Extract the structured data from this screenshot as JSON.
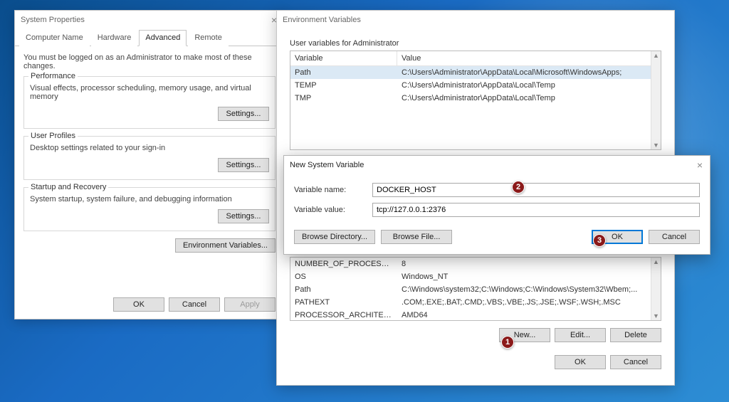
{
  "sysprops": {
    "title": "System Properties",
    "tabs": [
      "Computer Name",
      "Hardware",
      "Advanced",
      "Remote"
    ],
    "active_tab": 2,
    "note": "You must be logged on as an Administrator to make most of these changes.",
    "perf": {
      "legend": "Performance",
      "desc": "Visual effects, processor scheduling, memory usage, and virtual memory",
      "btn": "Settings..."
    },
    "profiles": {
      "legend": "User Profiles",
      "desc": "Desktop settings related to your sign-in",
      "btn": "Settings..."
    },
    "startup": {
      "legend": "Startup and Recovery",
      "desc": "System startup, system failure, and debugging information",
      "btn": "Settings..."
    },
    "envvars_btn": "Environment Variables...",
    "ok": "OK",
    "cancel": "Cancel",
    "apply": "Apply"
  },
  "envvars": {
    "title": "Environment Variables",
    "user_section": "User variables for Administrator",
    "col_variable": "Variable",
    "col_value": "Value",
    "user_vars": [
      {
        "name": "Path",
        "value": "C:\\Users\\Administrator\\AppData\\Local\\Microsoft\\WindowsApps;"
      },
      {
        "name": "TEMP",
        "value": "C:\\Users\\Administrator\\AppData\\Local\\Temp"
      },
      {
        "name": "TMP",
        "value": "C:\\Users\\Administrator\\AppData\\Local\\Temp"
      }
    ],
    "sys_vars": [
      {
        "name": "NUMBER_OF_PROCESSORS",
        "value": "8"
      },
      {
        "name": "OS",
        "value": "Windows_NT"
      },
      {
        "name": "Path",
        "value": "C:\\Windows\\system32;C:\\Windows;C:\\Windows\\System32\\Wbem;..."
      },
      {
        "name": "PATHEXT",
        "value": ".COM;.EXE;.BAT;.CMD;.VBS;.VBE;.JS;.JSE;.WSF;.WSH;.MSC"
      },
      {
        "name": "PROCESSOR_ARCHITECTURE",
        "value": "AMD64"
      }
    ],
    "new": "New...",
    "edit": "Edit...",
    "delete": "Delete",
    "ok": "OK",
    "cancel": "Cancel"
  },
  "newvar": {
    "title": "New System Variable",
    "name_label": "Variable name:",
    "value_label": "Variable value:",
    "name_value": "DOCKER_HOST",
    "value_value": "tcp://127.0.0.1:2376",
    "browse_dir": "Browse Directory...",
    "browse_file": "Browse File...",
    "ok": "OK",
    "cancel": "Cancel"
  },
  "annotations": {
    "b1": "1",
    "b2": "2",
    "b3": "3"
  }
}
